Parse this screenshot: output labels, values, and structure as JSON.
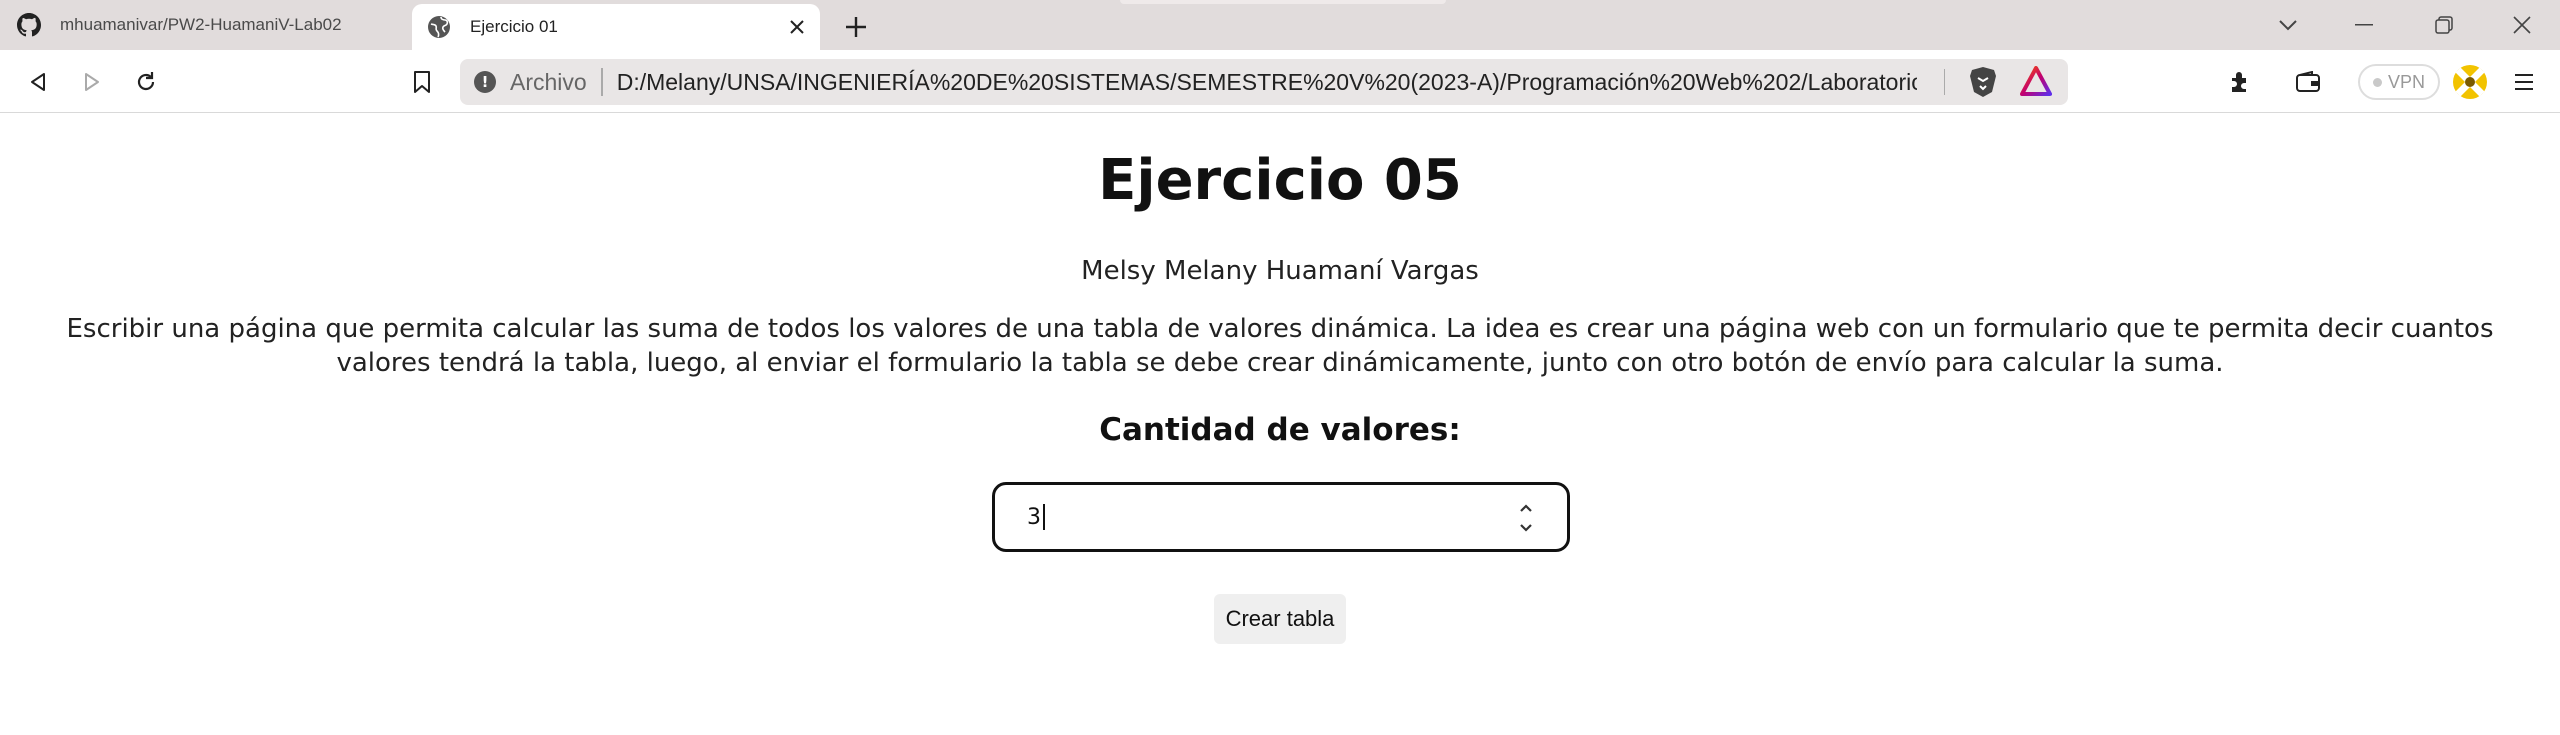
{
  "browser": {
    "tabs": [
      {
        "title": "mhuamanivar/PW2-HuamaniV-Lab02",
        "favicon": "github-icon",
        "active": false
      },
      {
        "title": "Ejercicio 01",
        "favicon": "globe-icon",
        "active": true
      }
    ],
    "address": {
      "scheme_label": "Archivo",
      "url": "D:/Melany/UNSA/INGENIERÍA%20DE%20SISTEMAS/SEMESTRE%20V%20(2023-A)/Programación%20Web%202/Laboratorio..."
    },
    "vpn_label": "VPN",
    "icons": [
      "back-icon",
      "forward-icon",
      "reload-icon",
      "bookmark-icon",
      "info-icon",
      "brave-shields-icon",
      "brave-rewards-icon",
      "extensions-icon",
      "wallet-icon",
      "profile-icon",
      "menu-icon",
      "new-tab-icon",
      "tab-search-icon",
      "minimize-icon",
      "restore-icon",
      "close-window-icon"
    ]
  },
  "page": {
    "title": "Ejercicio 05",
    "author": "Melsy Melany Huamaní Vargas",
    "description": "Escribir una página que permita calcular las suma de todos los valores de una tabla de valores dinámica. La idea es crear una página web con un formulario que te permita decir cuantos valores tendrá la tabla, luego, al enviar el formulario la tabla se debe crear dinámicamente, junto con otro botón de envío para calcular la suma.",
    "form": {
      "label": "Cantidad de valores:",
      "input_value": "3",
      "submit_label": "Crear tabla"
    }
  }
}
